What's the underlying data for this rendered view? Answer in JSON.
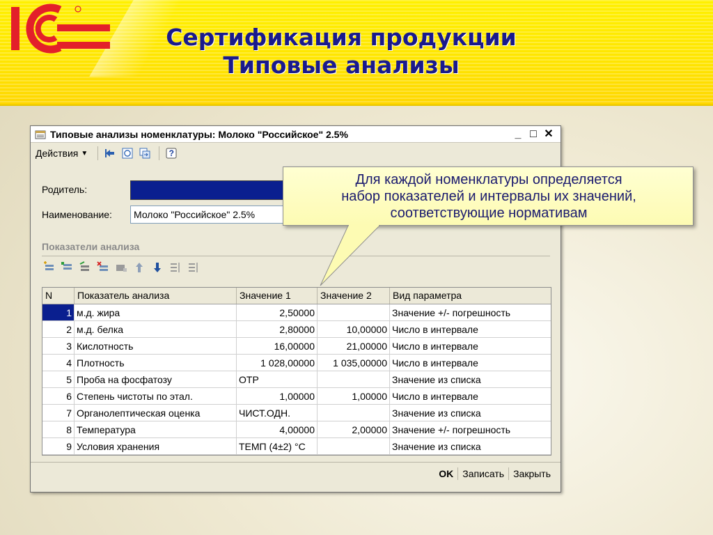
{
  "slide": {
    "title_line1": "Сертификация продукции",
    "title_line2": "Типовые анализы"
  },
  "window": {
    "title": "Типовые анализы номенклатуры: Молоко \"Российское\" 2.5%",
    "controls": {
      "minimize": "_",
      "maximize": "□",
      "close": "✕"
    }
  },
  "toolbar": {
    "actions_label": "Действия",
    "actions_arrow": "▼",
    "help_label": "?"
  },
  "form": {
    "parent_label": "Родитель:",
    "name_label": "Наименование:",
    "name_value": "Молоко \"Российское\" 2.5%"
  },
  "analysis": {
    "section_title": "Показатели анализа",
    "columns": [
      "N",
      "Показатель анализа",
      "Значение 1",
      "Значение 2",
      "Вид параметра"
    ],
    "rows": [
      {
        "n": "1",
        "name": "м.д. жира",
        "v1": "2,50000",
        "v2": "",
        "type": "Значение +/- погрешность"
      },
      {
        "n": "2",
        "name": "м.д. белка",
        "v1": "2,80000",
        "v2": "10,00000",
        "type": "Число в интервале"
      },
      {
        "n": "3",
        "name": "Кислотность",
        "v1": "16,00000",
        "v2": "21,00000",
        "type": "Число в интервале"
      },
      {
        "n": "4",
        "name": "Плотность",
        "v1": "1 028,00000",
        "v2": "1 035,00000",
        "type": "Число в интервале"
      },
      {
        "n": "5",
        "name": "Проба на фосфатозу",
        "v1": "ОТР",
        "v2": "",
        "type": "Значение из списка"
      },
      {
        "n": "6",
        "name": "Степень чистоты по этал.",
        "v1": "1,00000",
        "v2": "1,00000",
        "type": "Число в интервале"
      },
      {
        "n": "7",
        "name": "Органолептическая оценка",
        "v1": "ЧИСТ.ОДН.",
        "v2": "",
        "type": "Значение из списка"
      },
      {
        "n": "8",
        "name": "Температура",
        "v1": "4,00000",
        "v2": "2,00000",
        "type": "Значение +/- погрешность"
      },
      {
        "n": "9",
        "name": "Условия хранения",
        "v1": "ТЕМП (4±2) °C",
        "v2": "",
        "type": "Значение из списка"
      }
    ]
  },
  "footer": {
    "ok_label": "OK",
    "save_label": "Записать",
    "close_label": "Закрыть"
  },
  "callout": {
    "line1": "Для каждой номенклатуры определяется",
    "line2": "набор показателей и интервалы их значений,",
    "line3": "соответствующие нормативам"
  },
  "colors": {
    "header_yellow": "#ffe600",
    "title_blue": "#1a1a8c",
    "logo_red": "#e3202a",
    "selection_blue": "#0a1f8f",
    "callout_yellow": "#fdfbb3"
  }
}
